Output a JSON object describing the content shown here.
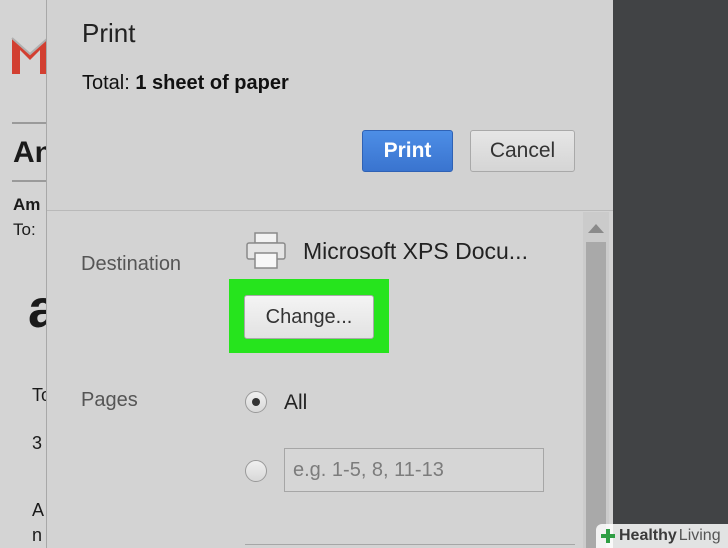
{
  "background_email": {
    "heading_partial": "An",
    "from_partial": "Am",
    "to_label": "To:",
    "logo_partial": "a",
    "line1": "To",
    "line2": "3",
    "line3": "A",
    "line4": "n"
  },
  "dialog": {
    "title": "Print",
    "total_label": "Total:",
    "total_value": "1 sheet of paper",
    "print_button": "Print",
    "cancel_button": "Cancel",
    "destination": {
      "label": "Destination",
      "printer_name": "Microsoft XPS Docu...",
      "change_button": "Change..."
    },
    "pages": {
      "label": "Pages",
      "all_option": "All",
      "selected": "All",
      "range_placeholder": "e.g. 1-5, 8, 11-13"
    }
  },
  "colors": {
    "print_button": "#3a74cf",
    "highlight": "#26e41d",
    "right_panel": "#414345"
  },
  "watermark": {
    "brand_bold": "Healthy",
    "brand_light": "Living"
  }
}
